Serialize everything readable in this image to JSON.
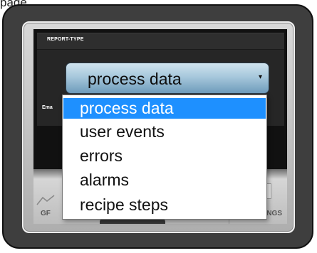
{
  "page": {
    "top_fragment": "page"
  },
  "report_panel": {
    "title": "REPORT-TYPE",
    "field_label_fragment": "Ema"
  },
  "report_type_select": {
    "value": "process data",
    "arrow": "▾"
  },
  "dropdown": {
    "options": [
      "process data",
      "user events",
      "errors",
      "alarms",
      "recipe steps"
    ],
    "selected_index": 0
  },
  "bottom_nav": {
    "left_fragment": "GF",
    "right_fragment": "NGS",
    "icons": [
      "graph-icon",
      "settings-icon"
    ]
  },
  "colors": {
    "selected_option": "#1e90ff",
    "select_gradient_top": "#cfe3ef",
    "select_gradient_bottom": "#6e9bbb",
    "device_frame": "#3e3e3e",
    "screen_background": "#111111"
  }
}
